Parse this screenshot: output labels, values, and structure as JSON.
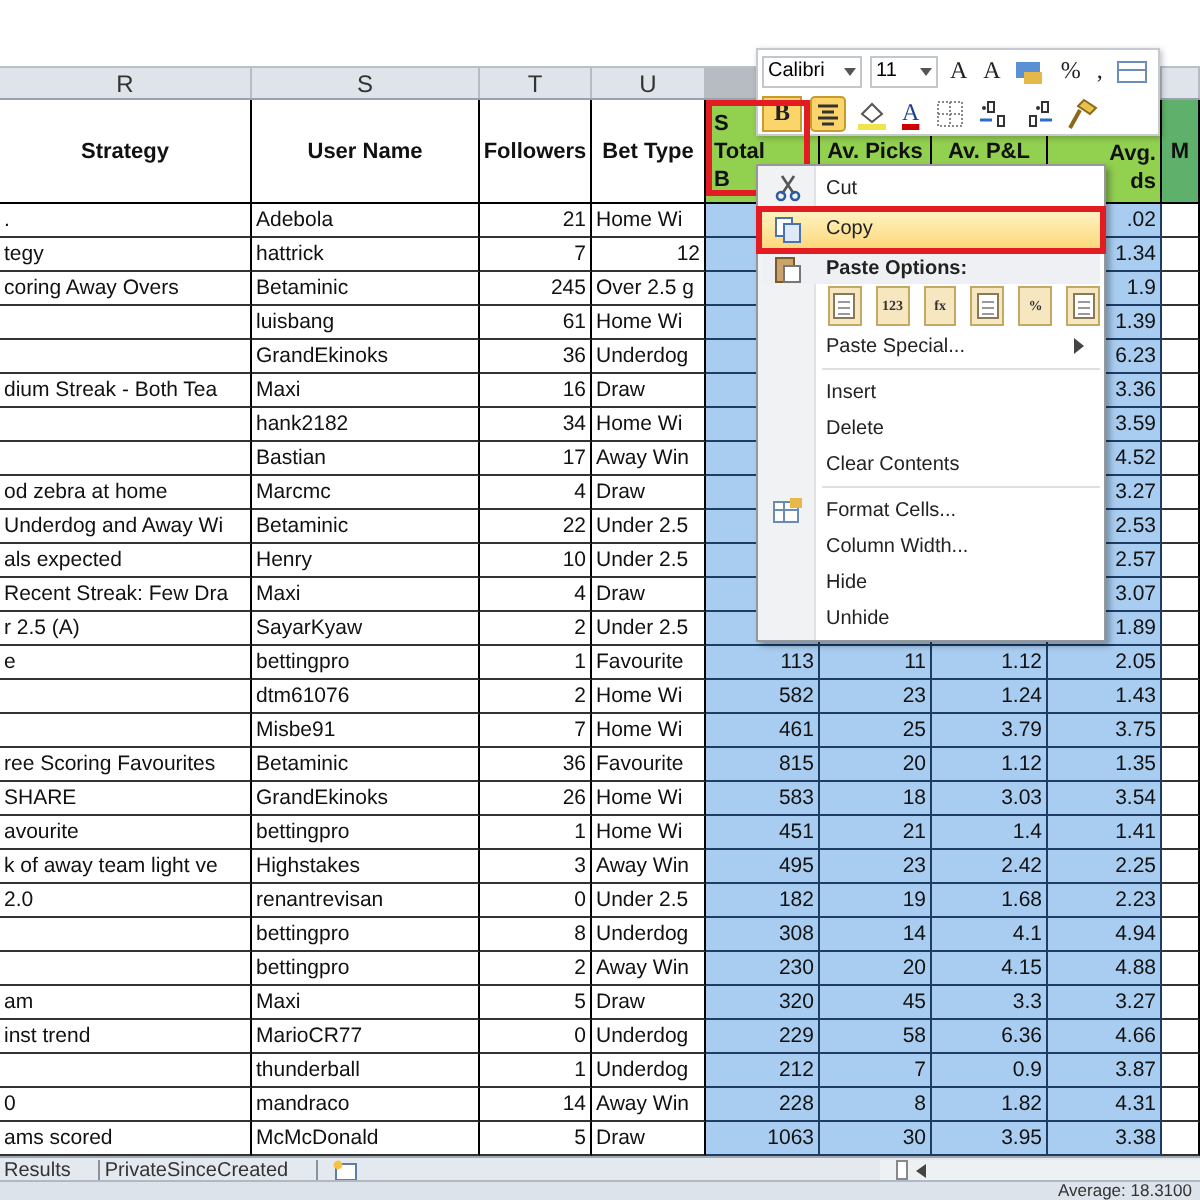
{
  "columns": [
    {
      "letter": "R",
      "header": [
        "Strategy"
      ],
      "selected": false,
      "color": "#ffffff"
    },
    {
      "letter": "S",
      "header": [
        "User Name"
      ],
      "selected": false,
      "color": "#ffffff"
    },
    {
      "letter": "T",
      "header": [
        "Followers"
      ],
      "selected": false,
      "color": "#ffffff"
    },
    {
      "letter": "U",
      "header": [
        "Bet Type"
      ],
      "selected": false,
      "color": "#ffffff"
    },
    {
      "header": [
        "S",
        "Total",
        "B"
      ],
      "selected": true,
      "color": "#92d050"
    },
    {
      "header": [
        "Av. Picks"
      ],
      "selected": true,
      "color": "#92d050"
    },
    {
      "header": [
        "Av. P&L"
      ],
      "selected": true,
      "color": "#92d050"
    },
    {
      "header": [
        "Avg.",
        "ds"
      ],
      "selected": true,
      "color": "#92d050"
    },
    {
      "header": [
        "M"
      ],
      "selected": false,
      "color": "#5fb06a"
    }
  ],
  "rows": [
    {
      "cells": [
        ".",
        "Adebola",
        "21",
        "Home Wi",
        null,
        null,
        null,
        ".02"
      ]
    },
    {
      "cells": [
        "tegy",
        "hattrick",
        "7",
        "12",
        null,
        null,
        null,
        "1.34"
      ]
    },
    {
      "cells": [
        "coring Away Overs",
        "Betaminic",
        "245",
        "Over 2.5 g",
        null,
        null,
        null,
        "1.9"
      ]
    },
    {
      "cells": [
        null,
        "luisbang",
        "61",
        "Home Wi",
        null,
        null,
        null,
        "1.39"
      ]
    },
    {
      "cells": [
        null,
        "GrandEkinoks",
        "36",
        "Underdog",
        null,
        null,
        null,
        "6.23"
      ]
    },
    {
      "cells": [
        "dium Streak - Both Tea",
        "Maxi",
        "16",
        "Draw",
        null,
        null,
        null,
        "3.36"
      ]
    },
    {
      "cells": [
        null,
        "hank2182",
        "34",
        "Home Wi",
        null,
        null,
        null,
        "3.59"
      ]
    },
    {
      "cells": [
        null,
        "Bastian",
        "17",
        "Away Win",
        null,
        null,
        null,
        "4.52"
      ]
    },
    {
      "cells": [
        "od zebra at home",
        "Marcmc",
        "4",
        "Draw",
        null,
        null,
        null,
        "3.27"
      ]
    },
    {
      "cells": [
        "Underdog and Away Wi",
        "Betaminic",
        "22",
        "Under 2.5",
        null,
        null,
        null,
        "2.53"
      ]
    },
    {
      "cells": [
        "als expected",
        "Henry",
        "10",
        "Under 2.5",
        null,
        null,
        null,
        "2.57"
      ]
    },
    {
      "cells": [
        "Recent Streak: Few Dra",
        "Maxi",
        "4",
        "Draw",
        null,
        null,
        null,
        "3.07"
      ]
    },
    {
      "cells": [
        "r 2.5 (A)",
        "SayarKyaw",
        "2",
        "Under 2.5",
        null,
        null,
        null,
        "1.89"
      ]
    },
    {
      "cells": [
        "e",
        "bettingpro",
        "1",
        "Favourite",
        "113",
        "11",
        "1.12",
        "2.05"
      ]
    },
    {
      "cells": [
        null,
        "dtm61076",
        "2",
        "Home Wi",
        "582",
        "23",
        "1.24",
        "1.43"
      ]
    },
    {
      "cells": [
        null,
        "Misbe91",
        "7",
        "Home Wi",
        "461",
        "25",
        "3.79",
        "3.75"
      ]
    },
    {
      "cells": [
        "ree Scoring Favourites",
        "Betaminic",
        "36",
        "Favourite",
        "815",
        "20",
        "1.12",
        "1.35"
      ]
    },
    {
      "cells": [
        "SHARE",
        "GrandEkinoks",
        "26",
        "Home Wi",
        "583",
        "18",
        "3.03",
        "3.54"
      ]
    },
    {
      "cells": [
        "avourite",
        "bettingpro",
        "1",
        "Home Wi",
        "451",
        "21",
        "1.4",
        "1.41"
      ]
    },
    {
      "cells": [
        "k of away team light ve",
        "Highstakes",
        "3",
        "Away Win",
        "495",
        "23",
        "2.42",
        "2.25"
      ]
    },
    {
      "cells": [
        "2.0",
        "renantrevisan",
        "0",
        "Under 2.5",
        "182",
        "19",
        "1.68",
        "2.23"
      ]
    },
    {
      "cells": [
        null,
        "bettingpro",
        "8",
        "Underdog",
        "308",
        "14",
        "4.1",
        "4.94"
      ]
    },
    {
      "cells": [
        null,
        "bettingpro",
        "2",
        "Away Win",
        "230",
        "20",
        "4.15",
        "4.88"
      ]
    },
    {
      "cells": [
        "am",
        "Maxi",
        "5",
        "Draw",
        "320",
        "45",
        "3.3",
        "3.27"
      ]
    },
    {
      "cells": [
        "inst trend",
        "MarioCR77",
        "0",
        "Underdog",
        "229",
        "58",
        "6.36",
        "4.66"
      ]
    },
    {
      "cells": [
        null,
        "thunderball",
        "1",
        "Underdog",
        "212",
        "7",
        "0.9",
        "3.87"
      ]
    },
    {
      "cells": [
        "0",
        "mandraco",
        "14",
        "Away Win",
        "228",
        "8",
        "1.82",
        "4.31"
      ]
    },
    {
      "cells": [
        "ams scored",
        "McMcDonald",
        "5",
        "Draw",
        "1063",
        "30",
        "3.95",
        "3.38"
      ]
    }
  ],
  "mini_toolbar": {
    "rows": [
      [
        {
          "kind": "font",
          "value": "Calibri"
        },
        {
          "kind": "size",
          "value": "11"
        },
        {
          "kind": "glyph",
          "label": "A"
        },
        {
          "kind": "glyph",
          "label": "A"
        },
        {
          "kind": "accounting"
        },
        {
          "kind": "glyph",
          "label": "%"
        },
        {
          "kind": "glyph",
          "label": ","
        },
        {
          "kind": "format"
        }
      ],
      [
        {
          "kind": "toggle",
          "label": "B",
          "on": true,
          "outlined": true
        },
        {
          "kind": "align",
          "on": true
        },
        {
          "kind": "fill"
        },
        {
          "kind": "fontcolor",
          "label": "A"
        },
        {
          "kind": "borders"
        },
        {
          "kind": "incdec"
        },
        {
          "kind": "decdec"
        },
        {
          "kind": "painter"
        }
      ]
    ]
  },
  "context_menu": {
    "items": [
      {
        "kind": "cut",
        "label": "Cut",
        "highlighted": false
      },
      {
        "kind": "copy",
        "label": "Copy",
        "highlighted": true,
        "outlined": true
      },
      {
        "kind": "header",
        "label": "Paste Options:"
      },
      {
        "kind": "icons",
        "icons": [
          {
            "kind": "clipboard"
          },
          {
            "kind": "text",
            "label": "123"
          },
          {
            "kind": "text",
            "label": "fx"
          },
          {
            "kind": "clipboard"
          },
          {
            "kind": "text",
            "label": "%"
          },
          {
            "kind": "clipboard"
          }
        ]
      },
      {
        "kind": "submenu",
        "label": "Paste Special...",
        "highlighted": false
      },
      {
        "kind": "plain",
        "label": "Insert",
        "highlighted": false,
        "separator_before": true
      },
      {
        "kind": "plain",
        "label": "Delete",
        "highlighted": false
      },
      {
        "kind": "plain",
        "label": "Clear Contents",
        "highlighted": false
      },
      {
        "kind": "format",
        "label": "Format Cells...",
        "highlighted": false,
        "separator_before": true
      },
      {
        "kind": "plain",
        "label": "Column Width...",
        "highlighted": false
      },
      {
        "kind": "plain",
        "label": "Hide",
        "highlighted": false
      },
      {
        "kind": "plain",
        "label": "Unhide",
        "highlighted": false
      }
    ]
  },
  "sheet_tabs": [
    {
      "label": "Results"
    },
    {
      "label": "PrivateSinceCreated"
    }
  ],
  "status_bar": {
    "text": "Average: 18.3100"
  }
}
